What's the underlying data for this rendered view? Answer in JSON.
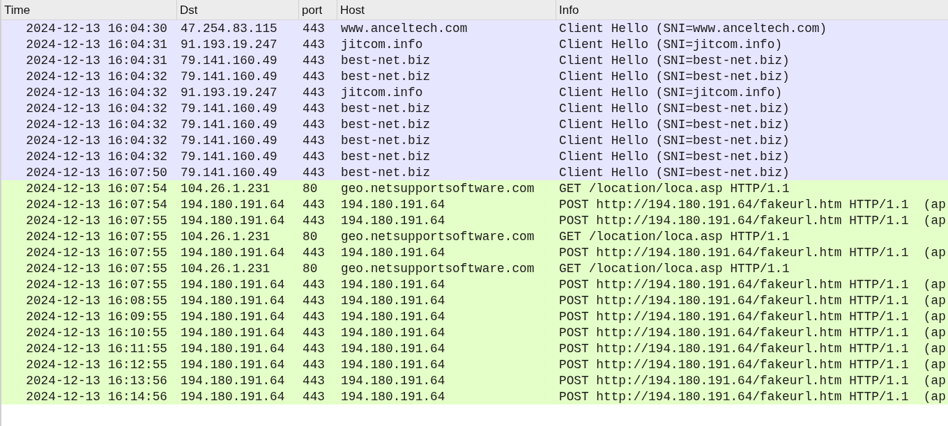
{
  "table": {
    "columns": [
      "Time",
      "Dst",
      "port",
      "Host",
      "Info"
    ],
    "rows": [
      {
        "time": "2024-12-13 16:04:30",
        "dst": "47.254.83.115",
        "port": "443",
        "host": "www.anceltech.com",
        "info": "Client Hello (SNI=www.anceltech.com)",
        "color": "#e7e6ff"
      },
      {
        "time": "2024-12-13 16:04:31",
        "dst": "91.193.19.247",
        "port": "443",
        "host": "jitcom.info",
        "info": "Client Hello (SNI=jitcom.info)",
        "color": "#e7e6ff"
      },
      {
        "time": "2024-12-13 16:04:31",
        "dst": "79.141.160.49",
        "port": "443",
        "host": "best-net.biz",
        "info": "Client Hello (SNI=best-net.biz)",
        "color": "#e7e6ff"
      },
      {
        "time": "2024-12-13 16:04:32",
        "dst": "79.141.160.49",
        "port": "443",
        "host": "best-net.biz",
        "info": "Client Hello (SNI=best-net.biz)",
        "color": "#e7e6ff"
      },
      {
        "time": "2024-12-13 16:04:32",
        "dst": "91.193.19.247",
        "port": "443",
        "host": "jitcom.info",
        "info": "Client Hello (SNI=jitcom.info)",
        "color": "#e7e6ff"
      },
      {
        "time": "2024-12-13 16:04:32",
        "dst": "79.141.160.49",
        "port": "443",
        "host": "best-net.biz",
        "info": "Client Hello (SNI=best-net.biz)",
        "color": "#e7e6ff"
      },
      {
        "time": "2024-12-13 16:04:32",
        "dst": "79.141.160.49",
        "port": "443",
        "host": "best-net.biz",
        "info": "Client Hello (SNI=best-net.biz)",
        "color": "#e7e6ff"
      },
      {
        "time": "2024-12-13 16:04:32",
        "dst": "79.141.160.49",
        "port": "443",
        "host": "best-net.biz",
        "info": "Client Hello (SNI=best-net.biz)",
        "color": "#e7e6ff"
      },
      {
        "time": "2024-12-13 16:04:32",
        "dst": "79.141.160.49",
        "port": "443",
        "host": "best-net.biz",
        "info": "Client Hello (SNI=best-net.biz)",
        "color": "#e7e6ff"
      },
      {
        "time": "2024-12-13 16:07:50",
        "dst": "79.141.160.49",
        "port": "443",
        "host": "best-net.biz",
        "info": "Client Hello (SNI=best-net.biz)",
        "color": "#e7e6ff"
      },
      {
        "time": "2024-12-13 16:07:54",
        "dst": "104.26.1.231",
        "port": "80",
        "host": "geo.netsupportsoftware.com",
        "info": "GET /location/loca.asp HTTP/1.1",
        "color": "#e4ffc7"
      },
      {
        "time": "2024-12-13 16:07:54",
        "dst": "194.180.191.64",
        "port": "443",
        "host": "194.180.191.64",
        "info": "POST http://194.180.191.64/fakeurl.htm HTTP/1.1  (ap",
        "color": "#e4ffc7"
      },
      {
        "time": "2024-12-13 16:07:55",
        "dst": "194.180.191.64",
        "port": "443",
        "host": "194.180.191.64",
        "info": "POST http://194.180.191.64/fakeurl.htm HTTP/1.1  (ap",
        "color": "#e4ffc7"
      },
      {
        "time": "2024-12-13 16:07:55",
        "dst": "104.26.1.231",
        "port": "80",
        "host": "geo.netsupportsoftware.com",
        "info": "GET /location/loca.asp HTTP/1.1",
        "color": "#e4ffc7"
      },
      {
        "time": "2024-12-13 16:07:55",
        "dst": "194.180.191.64",
        "port": "443",
        "host": "194.180.191.64",
        "info": "POST http://194.180.191.64/fakeurl.htm HTTP/1.1  (ap",
        "color": "#e4ffc7"
      },
      {
        "time": "2024-12-13 16:07:55",
        "dst": "104.26.1.231",
        "port": "80",
        "host": "geo.netsupportsoftware.com",
        "info": "GET /location/loca.asp HTTP/1.1",
        "color": "#e4ffc7"
      },
      {
        "time": "2024-12-13 16:07:55",
        "dst": "194.180.191.64",
        "port": "443",
        "host": "194.180.191.64",
        "info": "POST http://194.180.191.64/fakeurl.htm HTTP/1.1  (ap",
        "color": "#e4ffc7"
      },
      {
        "time": "2024-12-13 16:08:55",
        "dst": "194.180.191.64",
        "port": "443",
        "host": "194.180.191.64",
        "info": "POST http://194.180.191.64/fakeurl.htm HTTP/1.1  (ap",
        "color": "#e4ffc7"
      },
      {
        "time": "2024-12-13 16:09:55",
        "dst": "194.180.191.64",
        "port": "443",
        "host": "194.180.191.64",
        "info": "POST http://194.180.191.64/fakeurl.htm HTTP/1.1  (ap",
        "color": "#e4ffc7"
      },
      {
        "time": "2024-12-13 16:10:55",
        "dst": "194.180.191.64",
        "port": "443",
        "host": "194.180.191.64",
        "info": "POST http://194.180.191.64/fakeurl.htm HTTP/1.1  (ap",
        "color": "#e4ffc7"
      },
      {
        "time": "2024-12-13 16:11:55",
        "dst": "194.180.191.64",
        "port": "443",
        "host": "194.180.191.64",
        "info": "POST http://194.180.191.64/fakeurl.htm HTTP/1.1  (ap",
        "color": "#e4ffc7"
      },
      {
        "time": "2024-12-13 16:12:55",
        "dst": "194.180.191.64",
        "port": "443",
        "host": "194.180.191.64",
        "info": "POST http://194.180.191.64/fakeurl.htm HTTP/1.1  (ap",
        "color": "#e4ffc7"
      },
      {
        "time": "2024-12-13 16:13:56",
        "dst": "194.180.191.64",
        "port": "443",
        "host": "194.180.191.64",
        "info": "POST http://194.180.191.64/fakeurl.htm HTTP/1.1  (ap",
        "color": "#e4ffc7"
      },
      {
        "time": "2024-12-13 16:14:56",
        "dst": "194.180.191.64",
        "port": "443",
        "host": "194.180.191.64",
        "info": "POST http://194.180.191.64/fakeurl.htm HTTP/1.1  (ap",
        "color": "#e4ffc7"
      }
    ]
  }
}
